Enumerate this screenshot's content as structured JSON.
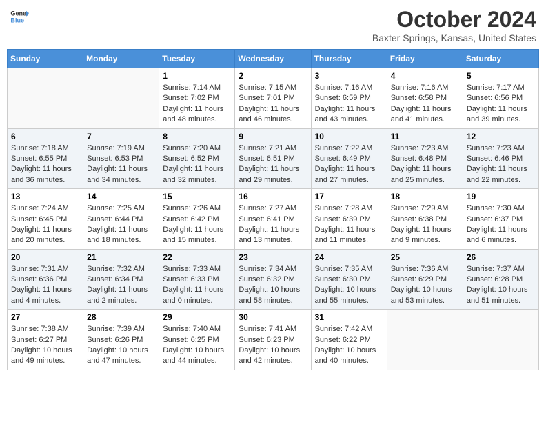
{
  "header": {
    "logo_general": "General",
    "logo_blue": "Blue",
    "month_title": "October 2024",
    "location": "Baxter Springs, Kansas, United States"
  },
  "days_of_week": [
    "Sunday",
    "Monday",
    "Tuesday",
    "Wednesday",
    "Thursday",
    "Friday",
    "Saturday"
  ],
  "weeks": [
    [
      {
        "num": "",
        "sunrise": "",
        "sunset": "",
        "daylight": ""
      },
      {
        "num": "",
        "sunrise": "",
        "sunset": "",
        "daylight": ""
      },
      {
        "num": "1",
        "sunrise": "Sunrise: 7:14 AM",
        "sunset": "Sunset: 7:02 PM",
        "daylight": "Daylight: 11 hours and 48 minutes."
      },
      {
        "num": "2",
        "sunrise": "Sunrise: 7:15 AM",
        "sunset": "Sunset: 7:01 PM",
        "daylight": "Daylight: 11 hours and 46 minutes."
      },
      {
        "num": "3",
        "sunrise": "Sunrise: 7:16 AM",
        "sunset": "Sunset: 6:59 PM",
        "daylight": "Daylight: 11 hours and 43 minutes."
      },
      {
        "num": "4",
        "sunrise": "Sunrise: 7:16 AM",
        "sunset": "Sunset: 6:58 PM",
        "daylight": "Daylight: 11 hours and 41 minutes."
      },
      {
        "num": "5",
        "sunrise": "Sunrise: 7:17 AM",
        "sunset": "Sunset: 6:56 PM",
        "daylight": "Daylight: 11 hours and 39 minutes."
      }
    ],
    [
      {
        "num": "6",
        "sunrise": "Sunrise: 7:18 AM",
        "sunset": "Sunset: 6:55 PM",
        "daylight": "Daylight: 11 hours and 36 minutes."
      },
      {
        "num": "7",
        "sunrise": "Sunrise: 7:19 AM",
        "sunset": "Sunset: 6:53 PM",
        "daylight": "Daylight: 11 hours and 34 minutes."
      },
      {
        "num": "8",
        "sunrise": "Sunrise: 7:20 AM",
        "sunset": "Sunset: 6:52 PM",
        "daylight": "Daylight: 11 hours and 32 minutes."
      },
      {
        "num": "9",
        "sunrise": "Sunrise: 7:21 AM",
        "sunset": "Sunset: 6:51 PM",
        "daylight": "Daylight: 11 hours and 29 minutes."
      },
      {
        "num": "10",
        "sunrise": "Sunrise: 7:22 AM",
        "sunset": "Sunset: 6:49 PM",
        "daylight": "Daylight: 11 hours and 27 minutes."
      },
      {
        "num": "11",
        "sunrise": "Sunrise: 7:23 AM",
        "sunset": "Sunset: 6:48 PM",
        "daylight": "Daylight: 11 hours and 25 minutes."
      },
      {
        "num": "12",
        "sunrise": "Sunrise: 7:23 AM",
        "sunset": "Sunset: 6:46 PM",
        "daylight": "Daylight: 11 hours and 22 minutes."
      }
    ],
    [
      {
        "num": "13",
        "sunrise": "Sunrise: 7:24 AM",
        "sunset": "Sunset: 6:45 PM",
        "daylight": "Daylight: 11 hours and 20 minutes."
      },
      {
        "num": "14",
        "sunrise": "Sunrise: 7:25 AM",
        "sunset": "Sunset: 6:44 PM",
        "daylight": "Daylight: 11 hours and 18 minutes."
      },
      {
        "num": "15",
        "sunrise": "Sunrise: 7:26 AM",
        "sunset": "Sunset: 6:42 PM",
        "daylight": "Daylight: 11 hours and 15 minutes."
      },
      {
        "num": "16",
        "sunrise": "Sunrise: 7:27 AM",
        "sunset": "Sunset: 6:41 PM",
        "daylight": "Daylight: 11 hours and 13 minutes."
      },
      {
        "num": "17",
        "sunrise": "Sunrise: 7:28 AM",
        "sunset": "Sunset: 6:39 PM",
        "daylight": "Daylight: 11 hours and 11 minutes."
      },
      {
        "num": "18",
        "sunrise": "Sunrise: 7:29 AM",
        "sunset": "Sunset: 6:38 PM",
        "daylight": "Daylight: 11 hours and 9 minutes."
      },
      {
        "num": "19",
        "sunrise": "Sunrise: 7:30 AM",
        "sunset": "Sunset: 6:37 PM",
        "daylight": "Daylight: 11 hours and 6 minutes."
      }
    ],
    [
      {
        "num": "20",
        "sunrise": "Sunrise: 7:31 AM",
        "sunset": "Sunset: 6:36 PM",
        "daylight": "Daylight: 11 hours and 4 minutes."
      },
      {
        "num": "21",
        "sunrise": "Sunrise: 7:32 AM",
        "sunset": "Sunset: 6:34 PM",
        "daylight": "Daylight: 11 hours and 2 minutes."
      },
      {
        "num": "22",
        "sunrise": "Sunrise: 7:33 AM",
        "sunset": "Sunset: 6:33 PM",
        "daylight": "Daylight: 11 hours and 0 minutes."
      },
      {
        "num": "23",
        "sunrise": "Sunrise: 7:34 AM",
        "sunset": "Sunset: 6:32 PM",
        "daylight": "Daylight: 10 hours and 58 minutes."
      },
      {
        "num": "24",
        "sunrise": "Sunrise: 7:35 AM",
        "sunset": "Sunset: 6:30 PM",
        "daylight": "Daylight: 10 hours and 55 minutes."
      },
      {
        "num": "25",
        "sunrise": "Sunrise: 7:36 AM",
        "sunset": "Sunset: 6:29 PM",
        "daylight": "Daylight: 10 hours and 53 minutes."
      },
      {
        "num": "26",
        "sunrise": "Sunrise: 7:37 AM",
        "sunset": "Sunset: 6:28 PM",
        "daylight": "Daylight: 10 hours and 51 minutes."
      }
    ],
    [
      {
        "num": "27",
        "sunrise": "Sunrise: 7:38 AM",
        "sunset": "Sunset: 6:27 PM",
        "daylight": "Daylight: 10 hours and 49 minutes."
      },
      {
        "num": "28",
        "sunrise": "Sunrise: 7:39 AM",
        "sunset": "Sunset: 6:26 PM",
        "daylight": "Daylight: 10 hours and 47 minutes."
      },
      {
        "num": "29",
        "sunrise": "Sunrise: 7:40 AM",
        "sunset": "Sunset: 6:25 PM",
        "daylight": "Daylight: 10 hours and 44 minutes."
      },
      {
        "num": "30",
        "sunrise": "Sunrise: 7:41 AM",
        "sunset": "Sunset: 6:23 PM",
        "daylight": "Daylight: 10 hours and 42 minutes."
      },
      {
        "num": "31",
        "sunrise": "Sunrise: 7:42 AM",
        "sunset": "Sunset: 6:22 PM",
        "daylight": "Daylight: 10 hours and 40 minutes."
      },
      {
        "num": "",
        "sunrise": "",
        "sunset": "",
        "daylight": ""
      },
      {
        "num": "",
        "sunrise": "",
        "sunset": "",
        "daylight": ""
      }
    ]
  ]
}
